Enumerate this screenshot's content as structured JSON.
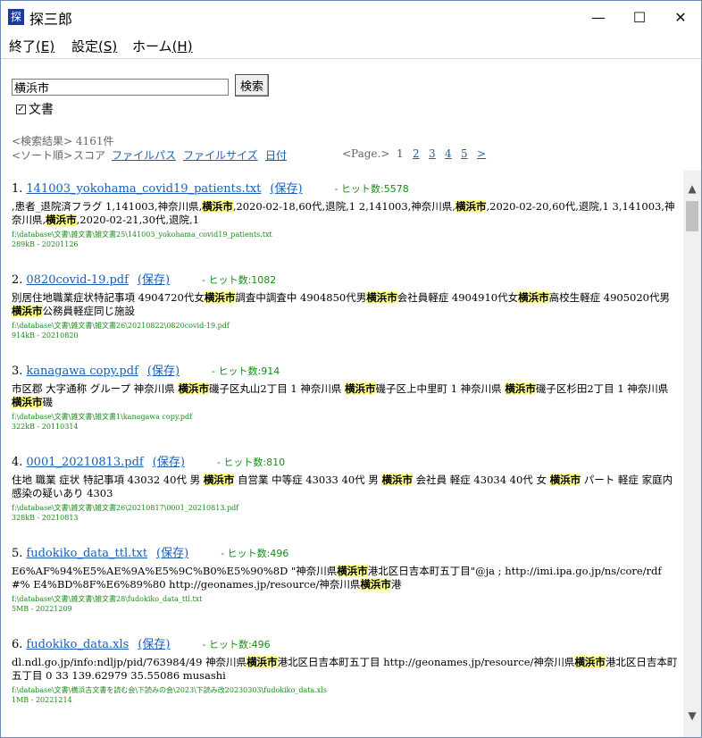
{
  "window": {
    "title": "探三郎",
    "icon_glyph": "探",
    "buttons": {
      "minimize": "—",
      "maximize": "☐",
      "close": "✕"
    }
  },
  "menu": [
    {
      "label": "終了",
      "mnemonic": "(E)"
    },
    {
      "label": "設定",
      "mnemonic": "(S)"
    },
    {
      "label": "ホーム",
      "mnemonic": "(H)"
    }
  ],
  "search": {
    "value": "横浜市",
    "button_label": "検索",
    "checkbox_label": "文書",
    "checkbox_checked": true
  },
  "result_count": "<検索結果> 4161件",
  "sort": {
    "label": "<ソート順>",
    "options": [
      "スコア",
      "ファイルパス",
      "ファイルサイズ",
      "日付"
    ]
  },
  "pager": {
    "label": "<Page.>",
    "pages": [
      "1",
      "2",
      "3",
      "4",
      "5"
    ],
    "next": ">"
  },
  "results": [
    {
      "index": "1.",
      "name": "141003_yokohama_covid19_patients.txt",
      "save": "(保存)",
      "hits": "- ヒット数:5578",
      "snippet": [
        {
          "t": ",患者_退院済フラグ 1,141003,神奈川県,",
          "h": false
        },
        {
          "t": "横浜市",
          "h": true
        },
        {
          "t": ",2020-02-18,60代,退院,1 2,141003,神奈川県,",
          "h": false
        },
        {
          "t": "横浜市",
          "h": true
        },
        {
          "t": ",2020-02-20,60代,退院,1 3,141003,神奈川県,",
          "h": false
        },
        {
          "t": "横浜市",
          "h": true
        },
        {
          "t": ",2020-02-21,30代,退院,1",
          "h": false
        }
      ],
      "path": "f:\\database\\文書\\雑文書\\雑文書25\\141003_yokohama_covid19_patients.txt",
      "meta": "289kB - 20201126"
    },
    {
      "index": "2.",
      "name": "0820covid-19.pdf",
      "save": "(保存)",
      "hits": "- ヒット数:1082",
      "snippet": [
        {
          "t": "別居住地職業症状特記事項 4904720代女",
          "h": false
        },
        {
          "t": "横浜市",
          "h": true
        },
        {
          "t": "調査中調査中 4904850代男",
          "h": false
        },
        {
          "t": "横浜市",
          "h": true
        },
        {
          "t": "会社員軽症 4904910代女",
          "h": false
        },
        {
          "t": "横浜市",
          "h": true
        },
        {
          "t": "高校生軽症 4905020代男",
          "h": false
        },
        {
          "t": "横浜市",
          "h": true
        },
        {
          "t": "公務員軽症同じ施設",
          "h": false
        }
      ],
      "path": "f:\\database\\文書\\雑文書\\雑文書26\\20210822\\0820covid-19.pdf",
      "meta": "914kB - 20210820"
    },
    {
      "index": "3.",
      "name": "kanagawa copy.pdf",
      "save": "(保存)",
      "hits": "- ヒット数:914",
      "snippet": [
        {
          "t": "市区郡 大字通称 グループ 神奈川県 ",
          "h": false
        },
        {
          "t": "横浜市",
          "h": true
        },
        {
          "t": "磯子区丸山2丁目 1 神奈川県 ",
          "h": false
        },
        {
          "t": "横浜市",
          "h": true
        },
        {
          "t": "磯子区上中里町 1 神奈川県 ",
          "h": false
        },
        {
          "t": "横浜市",
          "h": true
        },
        {
          "t": "磯子区杉田2丁目 1 神奈川県 ",
          "h": false
        },
        {
          "t": "横浜市",
          "h": true
        },
        {
          "t": "磯",
          "h": false
        }
      ],
      "path": "f:\\database\\文書\\雑文書\\雑文書1\\kanagawa copy.pdf",
      "meta": "322kB - 20110314"
    },
    {
      "index": "4.",
      "name": "0001_20210813.pdf",
      "save": "(保存)",
      "hits": "- ヒット数:810",
      "snippet": [
        {
          "t": "住地 職業 症状 特記事項 43032 40代 男 ",
          "h": false
        },
        {
          "t": "横浜市",
          "h": true
        },
        {
          "t": " 自営業 中等症 43033 40代 男 ",
          "h": false
        },
        {
          "t": "横浜市",
          "h": true
        },
        {
          "t": " 会社員 軽症 43034 40代 女 ",
          "h": false
        },
        {
          "t": "横浜市",
          "h": true
        },
        {
          "t": " パート 軽症 家庭内感染の疑いあり 4303",
          "h": false
        }
      ],
      "path": "f:\\database\\文書\\雑文書\\雑文書26\\20210817\\0001_20210813.pdf",
      "meta": "328kB - 20210813"
    },
    {
      "index": "5.",
      "name": "fudokiko_data_ttl.txt",
      "save": "(保存)",
      "hits": "- ヒット数:496",
      "snippet": [
        {
          "t": "E6%AF%94%E5%AE%9A%E5%9C%B0%E5%90%8D \"神奈川県",
          "h": false
        },
        {
          "t": "横浜市",
          "h": true
        },
        {
          "t": "港北区日吉本町五丁目\"@ja ; http://imi.ipa.go.jp/ns/core/rdf#% E4%BD%8F%E6%89%80 http://geonames.jp/resource/神奈川県",
          "h": false
        },
        {
          "t": "横浜市",
          "h": true
        },
        {
          "t": "港",
          "h": false
        }
      ],
      "path": "f:\\database\\文書\\雑文書\\雑文書28\\fudokiko_data_ttl.txt",
      "meta": "5MB - 20221209"
    },
    {
      "index": "6.",
      "name": "fudokiko_data.xls",
      "save": "(保存)",
      "hits": "- ヒット数:496",
      "snippet": [
        {
          "t": "dl.ndl.go.jp/info:ndljp/pid/763984/49 神奈川県",
          "h": false
        },
        {
          "t": "横浜市",
          "h": true
        },
        {
          "t": "港北区日吉本町五丁目 http://geonames.jp/resource/神奈川県",
          "h": false
        },
        {
          "t": "横浜市",
          "h": true
        },
        {
          "t": "港北区日吉本町五丁目 0 33 139.62979 35.55086 musashi",
          "h": false
        }
      ],
      "path": "f:\\database\\文書\\横浜古文書を読む会\\下読みの会\\2023\\下読み改20230303\\fudokiko_data.xls",
      "meta": "1MB - 20221214"
    }
  ],
  "scrollbar": {
    "up": "▲",
    "down": "▼"
  }
}
